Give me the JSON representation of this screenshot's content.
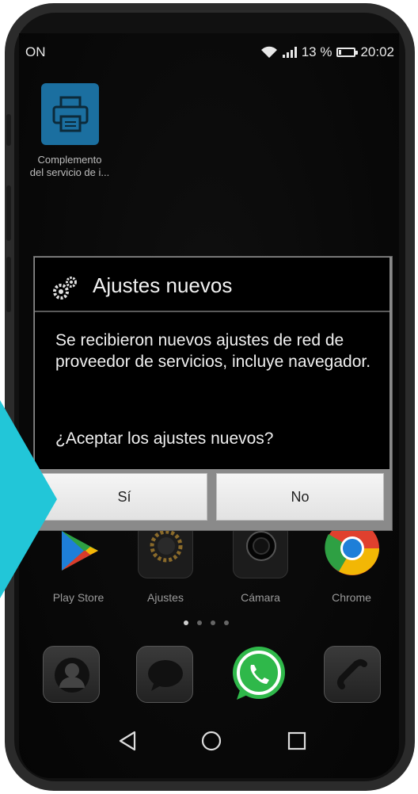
{
  "status_bar": {
    "carrier": "ON",
    "battery_percent": "13 %",
    "time": "20:02"
  },
  "home_app": {
    "label_line1": "Complemento",
    "label_line2": "del servicio de i..."
  },
  "dialog": {
    "title": "Ajustes nuevos",
    "message": "Se recibieron nuevos ajustes de red de proveedor de servicios, incluye navegador.",
    "question": "¿Aceptar los ajustes nuevos?",
    "yes_label": "Sí",
    "no_label": "No"
  },
  "dock_apps": [
    {
      "label": "Play Store"
    },
    {
      "label": "Ajustes"
    },
    {
      "label": "Cámara"
    },
    {
      "label": "Chrome"
    }
  ],
  "page_indicator": {
    "count": 4,
    "active": 0
  },
  "colors": {
    "accent_arrow": "#22c6d8",
    "printer_icon_bg": "#1b6fa0"
  }
}
